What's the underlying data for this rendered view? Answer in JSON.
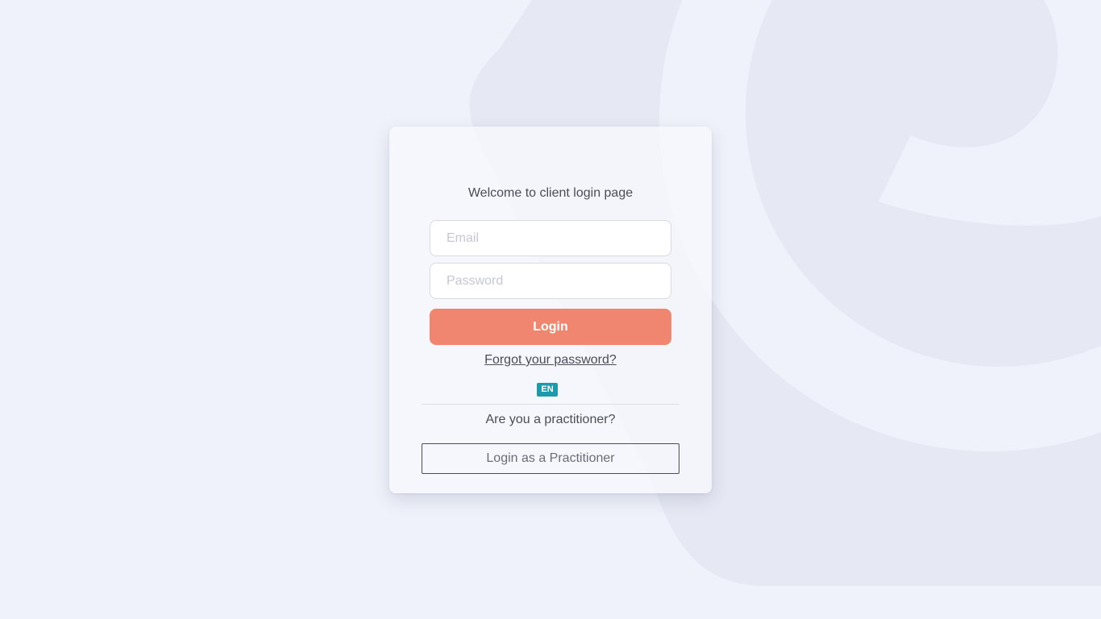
{
  "login": {
    "welcome": "Welcome to client login page",
    "email_placeholder": "Email",
    "email_value": "",
    "password_placeholder": "Password",
    "password_value": "",
    "login_button": "Login",
    "forgot_password": "Forgot your password?",
    "language": "EN",
    "practitioner_question": "Are you a practitioner?",
    "practitioner_button": "Login as a Practitioner"
  },
  "colors": {
    "page_background": "#eff2fa",
    "background_logo": "#e6e9f4",
    "login_button": "#f0866f",
    "language_badge": "#1e9aac",
    "text": "#4a4d57"
  }
}
